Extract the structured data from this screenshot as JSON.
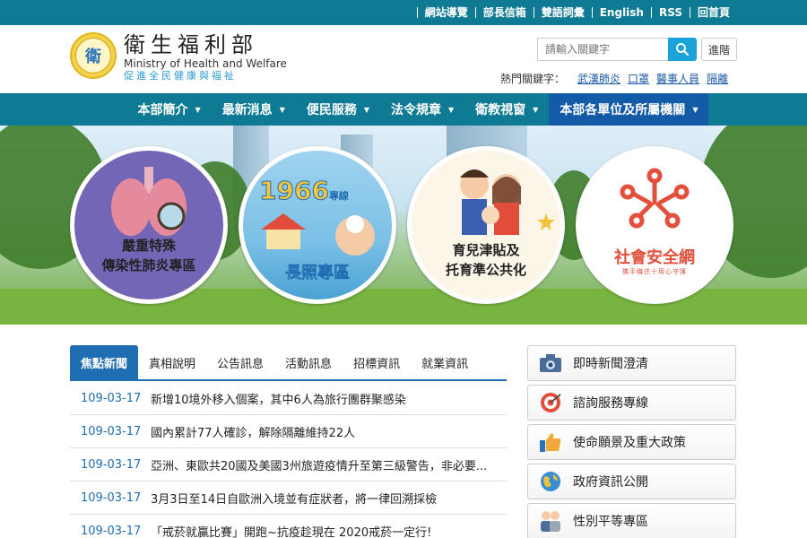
{
  "top_links": [
    "網站導覽",
    "部長信箱",
    "雙語詞彙",
    "English",
    "RSS",
    "回首頁"
  ],
  "logo": {
    "emblem_text": "衛",
    "name_zh": "衛生福利部",
    "name_en": "Ministry of Health and Welfare",
    "slogan": "促進全民健康與福祉"
  },
  "search": {
    "placeholder": "請輸入關鍵字",
    "login_label": "進階"
  },
  "hotwords": {
    "label": "熱門關鍵字：",
    "items": [
      "武漢肺炎",
      "口罩",
      "醫事人員",
      "隔離"
    ]
  },
  "nav": {
    "items": [
      {
        "label": "本部簡介",
        "active": false
      },
      {
        "label": "最新消息",
        "active": false
      },
      {
        "label": "便民服務",
        "active": false
      },
      {
        "label": "法令規章",
        "active": false
      },
      {
        "label": "衛教視窗",
        "active": false
      },
      {
        "label": "本部各單位及所屬機關",
        "active": true
      }
    ]
  },
  "banner": {
    "items": [
      {
        "line1": "嚴重特殊",
        "line2": "傳染性肺炎專區"
      },
      {
        "badge": "1966",
        "badge_suffix": "專線",
        "line1": "長照專區"
      },
      {
        "line1": "育兒津貼及",
        "line2": "托育準公共化"
      },
      {
        "line1": "社會安全網",
        "sub": "攜手織住十用心守護"
      }
    ]
  },
  "tabs": [
    "焦點新聞",
    "真相說明",
    "公告訊息",
    "活動訊息",
    "招標資訊",
    "就業資訊"
  ],
  "news": [
    {
      "date": "109-03-17",
      "title": "新增10境外移入個案，其中6人為旅行團群聚感染"
    },
    {
      "date": "109-03-17",
      "title": "國內累計77人確診，解除隔離維持22人"
    },
    {
      "date": "109-03-17",
      "title": "亞洲、東歐共20國及美國3州旅遊疫情升至第三級警告，非必要..."
    },
    {
      "date": "109-03-17",
      "title": "3月3日至14日自歐洲入境並有症狀者，將一律回溯採檢"
    },
    {
      "date": "109-03-17",
      "title": "「戒菸就贏比賽」開跑~抗疫趁現在 2020戒菸一定行!"
    }
  ],
  "side_buttons": [
    {
      "label": "即時新聞澄清",
      "icon": "camera-icon"
    },
    {
      "label": "諮詢服務專線",
      "icon": "target-icon"
    },
    {
      "label": "使命願景及重大政策",
      "icon": "thumbs-up-icon"
    },
    {
      "label": "政府資訊公開",
      "icon": "globe-icon"
    },
    {
      "label": "性別平等專區",
      "icon": "people-icon"
    }
  ],
  "colors": {
    "teal": "#0e7a94",
    "blue": "#1f6eb3",
    "nav_active": "#135ba6",
    "link": "#1a5aa8"
  }
}
